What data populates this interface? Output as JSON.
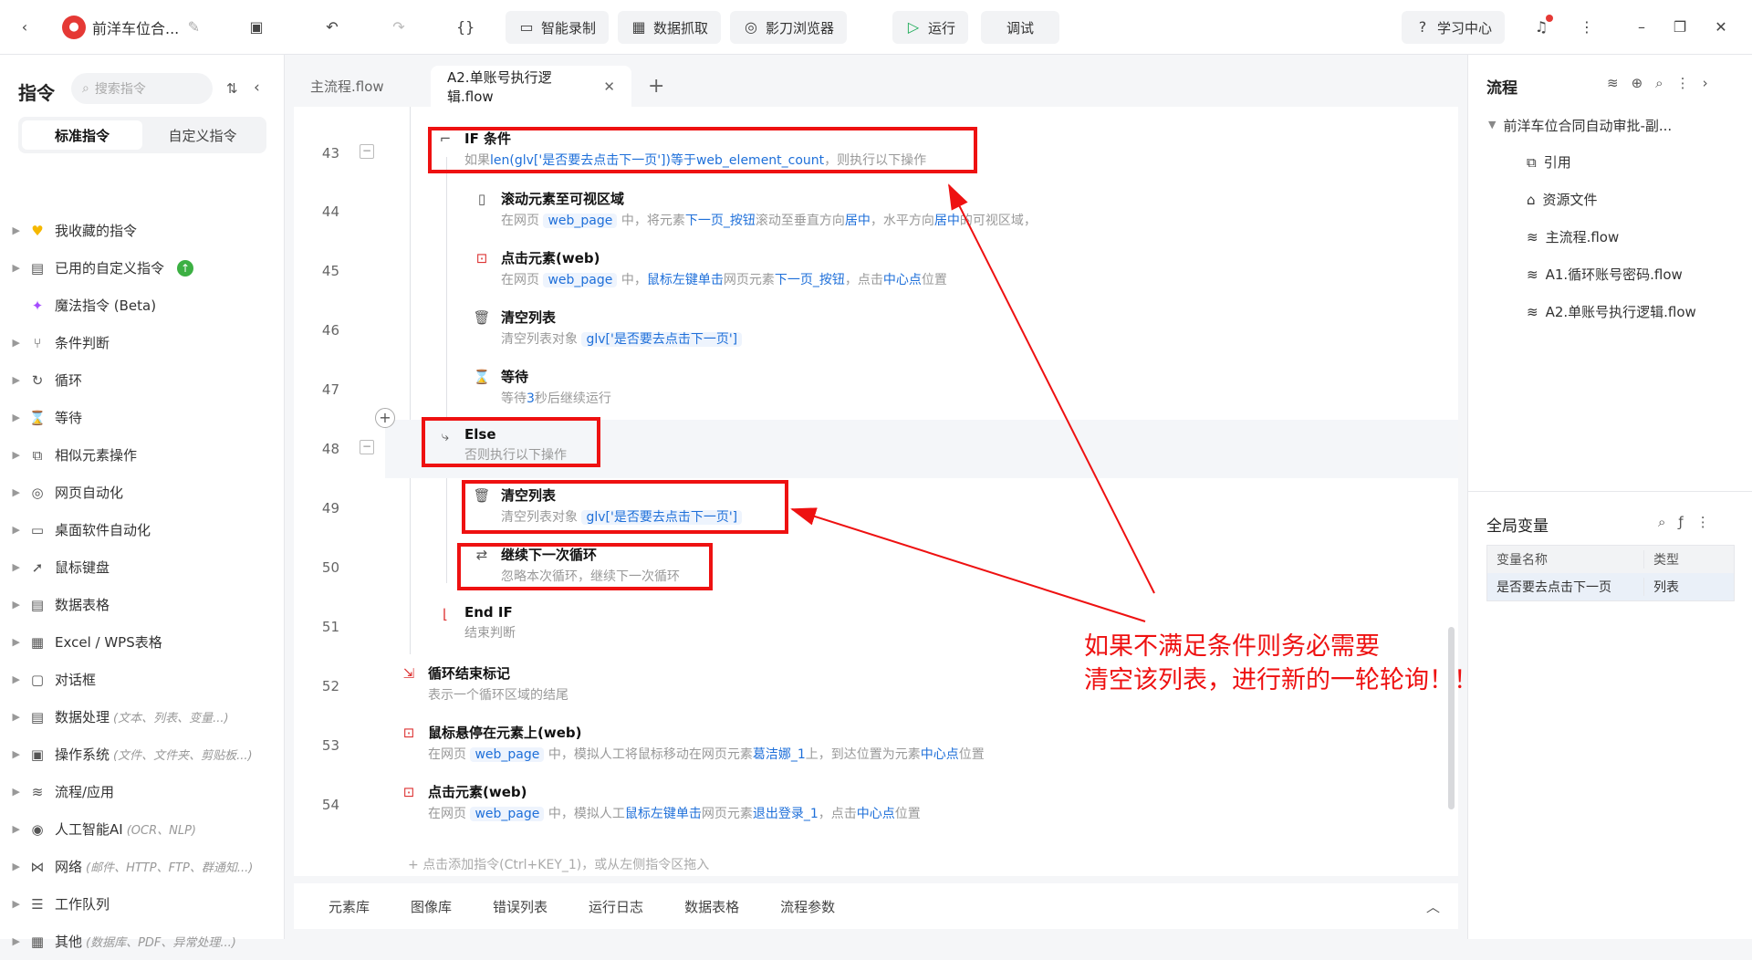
{
  "app": {
    "title": "前洋车位合...",
    "brand_color": "#1e6fd9",
    "annotation_color": "#ee1111"
  },
  "toolbar": {
    "smart_record": "智能录制",
    "data_capture": "数据抓取",
    "browser": "影刀浏览器",
    "run": "运行",
    "debug": "调试",
    "learning_center": "学习中心"
  },
  "left": {
    "title": "指令",
    "search_placeholder": "搜索指令",
    "tab_standard": "标准指令",
    "tab_custom": "自定义指令",
    "categories": [
      {
        "label": "我收藏的指令",
        "hint": "",
        "icon": "heart-icon"
      },
      {
        "label": "已用的自定义指令",
        "hint": "",
        "icon": "custom-icon"
      },
      {
        "label": "魔法指令 (Beta)",
        "hint": "",
        "icon": "sparkle-icon"
      },
      {
        "label": "条件判断",
        "hint": "",
        "icon": "branch-icon"
      },
      {
        "label": "循环",
        "hint": "",
        "icon": "loop-icon"
      },
      {
        "label": "等待",
        "hint": "",
        "icon": "hourglass-icon"
      },
      {
        "label": "相似元素操作",
        "hint": "",
        "icon": "copy-icon"
      },
      {
        "label": "网页自动化",
        "hint": "",
        "icon": "globe-icon"
      },
      {
        "label": "桌面软件自动化",
        "hint": "",
        "icon": "monitor-icon"
      },
      {
        "label": "鼠标键盘",
        "hint": "",
        "icon": "cursor-icon"
      },
      {
        "label": "数据表格",
        "hint": "",
        "icon": "sheet-icon"
      },
      {
        "label": "Excel / WPS表格",
        "hint": "",
        "icon": "excel-icon"
      },
      {
        "label": "对话框",
        "hint": "",
        "icon": "dialog-icon"
      },
      {
        "label": "数据处理",
        "hint": "(文本、列表、变量...)",
        "icon": "data-icon"
      },
      {
        "label": "操作系统",
        "hint": "(文件、文件夹、剪贴板...)",
        "icon": "os-icon"
      },
      {
        "label": "流程/应用",
        "hint": "",
        "icon": "layers-icon"
      },
      {
        "label": "人工智能AI",
        "hint": "(OCR、NLP)",
        "icon": "ai-icon"
      },
      {
        "label": "网络",
        "hint": "(邮件、HTTP、FTP、群通知...)",
        "icon": "network-icon"
      },
      {
        "label": "工作队列",
        "hint": "",
        "icon": "queue-icon"
      },
      {
        "label": "其他",
        "hint": "(数据库、PDF、异常处理...)",
        "icon": "grid-icon"
      }
    ]
  },
  "tabs": {
    "main": "主流程.flow",
    "current": "A2.单账号执行逻辑.flow",
    "add": "+"
  },
  "editor": {
    "l43": {
      "num": "43",
      "title": "IF 条件",
      "d1": "如果",
      "d2": "len(glv['是否要去点击下一页'])",
      "d3": "等于",
      "d4": "web_element_count",
      "d5": "，则执行以下操作"
    },
    "l44": {
      "num": "44",
      "title": "滚动元素至可视区域",
      "d1": "在网页",
      "d2": "web_page",
      "d3": "中，将元素",
      "d4": "下一页_按钮",
      "d5": "滚动至垂直方向",
      "d6": "居中",
      "d7": "，水平方向",
      "d8": "居中",
      "d9": "的可视区域，"
    },
    "l45": {
      "num": "45",
      "title": "点击元素(web)",
      "d1": "在网页",
      "d2": "web_page",
      "d3": "中，",
      "d4": "鼠标左键单击",
      "d5": "网页元素",
      "d6": "下一页_按钮",
      "d7": "，点击",
      "d8": "中心点",
      "d9": "位置"
    },
    "l46": {
      "num": "46",
      "title": "清空列表",
      "d1": "清空列表对象",
      "d2": "glv['是否要去点击下一页']"
    },
    "l47": {
      "num": "47",
      "title": "等待",
      "d1": "等待",
      "d2": "3",
      "d3": "秒后继续运行"
    },
    "l48": {
      "num": "48",
      "title": "Else",
      "d1": "否则执行以下操作"
    },
    "l49": {
      "num": "49",
      "title": "清空列表",
      "d1": "清空列表对象",
      "d2": "glv['是否要去点击下一页']"
    },
    "l50": {
      "num": "50",
      "title": "继续下一次循环",
      "d1": "忽略本次循环，继续下一次循环"
    },
    "l51": {
      "num": "51",
      "title": "End IF",
      "d1": "结束判断"
    },
    "l52": {
      "num": "52",
      "title": "循环结束标记",
      "d1": "表示一个循环区域的结尾"
    },
    "l53": {
      "num": "53",
      "title": "鼠标悬停在元素上(web)",
      "d1": "在网页",
      "d2": "web_page",
      "d3": "中，模拟人工将鼠标移动在网页元素",
      "d4": "葛洁娜_1",
      "d5": "上，到达位置为元素",
      "d6": "中心点",
      "d7": "位置"
    },
    "l54": {
      "num": "54",
      "title": "点击元素(web)",
      "d1": "在网页",
      "d2": "web_page",
      "d3": "中，模拟人工",
      "d4": "鼠标左键单击",
      "d5": "网页元素",
      "d6": "退出登录_1",
      "d7": "，点击",
      "d8": "中心点",
      "d9": "位置"
    },
    "add_hint": "点击添加指令(Ctrl+KEY_1)，或从左侧指令区拖入"
  },
  "annotation": {
    "line1": "如果不满足条件则务必需要",
    "line2": "清空该列表，进行新的一轮轮询！！！"
  },
  "bottom": {
    "t1": "元素库",
    "t2": "图像库",
    "t3": "错误列表",
    "t4": "运行日志",
    "t5": "数据表格",
    "t6": "流程参数"
  },
  "right": {
    "title": "流程",
    "project": "前洋车位合同自动审批-副...",
    "items": [
      "引用",
      "资源文件",
      "主流程.flow",
      "A1.循环账号密码.flow",
      "A2.单账号执行逻辑.flow"
    ],
    "globals_title": "全局变量",
    "col_name": "变量名称",
    "col_type": "类型",
    "var_name": "是否要去点击下一页",
    "var_type": "列表"
  }
}
